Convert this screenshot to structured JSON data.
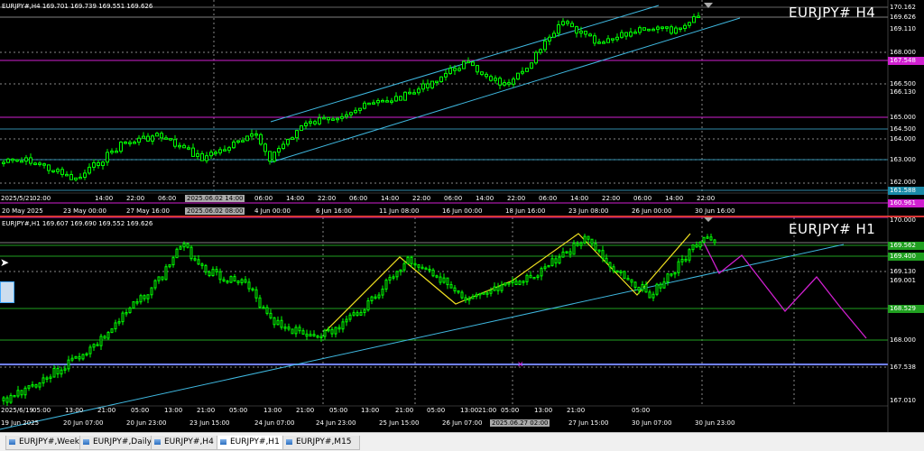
{
  "top_chart": {
    "info": "EURJPY#,H4 169.701 169.739 169.551 169.626",
    "title": "EURJPY#  H4",
    "prices": [
      {
        "label": "170.162",
        "hl": false,
        "color": ""
      },
      {
        "label": "169.626",
        "hl": false,
        "color": ""
      },
      {
        "label": "169.110",
        "hl": false,
        "color": ""
      },
      {
        "label": "168.000",
        "hl": false,
        "color": ""
      },
      {
        "label": "167.548",
        "hl": true,
        "color": "#d020d0"
      },
      {
        "label": "166.500",
        "hl": false,
        "color": ""
      },
      {
        "label": "166.130",
        "hl": false,
        "color": ""
      },
      {
        "label": "165.000",
        "hl": false,
        "color": ""
      },
      {
        "label": "164.500",
        "hl": false,
        "color": ""
      },
      {
        "label": "164.000",
        "hl": false,
        "color": ""
      },
      {
        "label": "163.000",
        "hl": false,
        "color": ""
      },
      {
        "label": "162.000",
        "hl": false,
        "color": ""
      },
      {
        "label": "161.588",
        "hl": true,
        "color": "#1a8aa8"
      },
      {
        "label": "160.961",
        "hl": true,
        "color": "#d020d0"
      }
    ],
    "time_row1": [
      "2025/5/21",
      "02:00",
      "14:00",
      "22:00",
      "06:00",
      "14:00",
      "2025.06.02 14:00",
      "06:00",
      "14:00",
      "22:00",
      "06:00",
      "14:00",
      "22:00",
      "06:00",
      "14:00",
      "22:00",
      "06:00",
      "14:00",
      "22:00",
      "06:00",
      "14:00",
      "22:00"
    ],
    "time_row2": [
      "20 May 2025",
      "23 May 00:00",
      "27 May 16:00",
      "2025.06.02 08:00",
      "4 Jun 00:00",
      "6 Jun 16:00",
      "11 Jun 08:00",
      "16 Jun 00:00",
      "18 Jun 16:00",
      "23 Jun 08:00",
      "26 Jun 00:00",
      "30 Jun 16:00"
    ]
  },
  "bottom_chart": {
    "info": "EURJPY#,H1 169.607 169.690 169.552 169.626",
    "title": "EURJPY#  H1",
    "prices": [
      {
        "label": "170.000",
        "hl": false,
        "color": ""
      },
      {
        "label": "169.562",
        "hl": true,
        "color": "#20a020"
      },
      {
        "label": "169.400",
        "hl": true,
        "color": "#20a020"
      },
      {
        "label": "169.130",
        "hl": false,
        "color": ""
      },
      {
        "label": "169.001",
        "hl": false,
        "color": ""
      },
      {
        "label": "168.529",
        "hl": true,
        "color": "#20a020"
      },
      {
        "label": "168.000",
        "hl": false,
        "color": ""
      },
      {
        "label": "167.538",
        "hl": false,
        "color": ""
      },
      {
        "label": "167.010",
        "hl": false,
        "color": ""
      }
    ],
    "time_row1": [
      "2025/6/19",
      "05:00",
      "13:00",
      "21:00",
      "05:00",
      "13:00",
      "21:00",
      "05:00",
      "13:00",
      "21:00",
      "05:00",
      "13:00",
      "21:00",
      "05:00",
      "13:00",
      "21:00",
      "05:00",
      "13:00",
      "21:00",
      "05:00"
    ],
    "time_row2": [
      "19 Jun 2025",
      "20 Jun 07:00",
      "20 Jun 23:00",
      "23 Jun 15:00",
      "24 Jun 07:00",
      "24 Jun 23:00",
      "25 Jun 15:00",
      "26 Jun 07:00",
      "2025.06.27 02:00",
      "27 Jun 15:00",
      "30 Jun 07:00",
      "30 Jun 23:00"
    ]
  },
  "tabs": [
    {
      "label": "EURJPY#,Weekly",
      "active": false
    },
    {
      "label": "EURJPY#,Daily",
      "active": false
    },
    {
      "label": "EURJPY#,H4",
      "active": false
    },
    {
      "label": "EURJPY#,H1",
      "active": true
    },
    {
      "label": "EURJPY#,M15",
      "active": false
    }
  ],
  "colors": {
    "bull": "#00ff00",
    "channel": "#3fb8e0",
    "magenta": "#d020d0",
    "zigzag": "#f0e020",
    "forecast": "#d020d0",
    "grid": "#555",
    "green_level": "#20a020"
  }
}
